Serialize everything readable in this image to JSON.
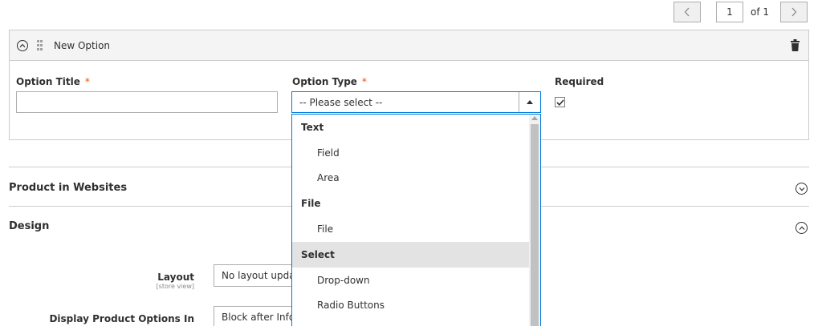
{
  "pager": {
    "prev_icon": "chevron-left-icon",
    "page": "1",
    "of_label": "of 1",
    "next_icon": "chevron-right-icon"
  },
  "option": {
    "title": "New Option",
    "option_title_label": "Option Title",
    "option_title_value": "",
    "required_marker": "*",
    "option_type_label": "Option Type",
    "option_type_selected": "-- Please select --",
    "required_label": "Required",
    "required_checked": true
  },
  "dropdown": {
    "items": [
      {
        "label": "Text",
        "group": true
      },
      {
        "label": "Field",
        "group": false
      },
      {
        "label": "Area",
        "group": false
      },
      {
        "label": "File",
        "group": true
      },
      {
        "label": "File",
        "group": false
      },
      {
        "label": "Select",
        "group": true,
        "highlighted": true
      },
      {
        "label": "Drop-down",
        "group": false
      },
      {
        "label": "Radio Buttons",
        "group": false
      }
    ]
  },
  "sections": {
    "websites": "Product in Websites",
    "design": "Design"
  },
  "design": {
    "layout_label": "Layout",
    "layout_scope": "[store view]",
    "layout_value": "No layout updat",
    "display_label": "Display Product Options In",
    "display_value": "Block after Info C"
  },
  "colors": {
    "accent": "#007bdb",
    "required": "#eb5202",
    "border": "#adadad"
  }
}
